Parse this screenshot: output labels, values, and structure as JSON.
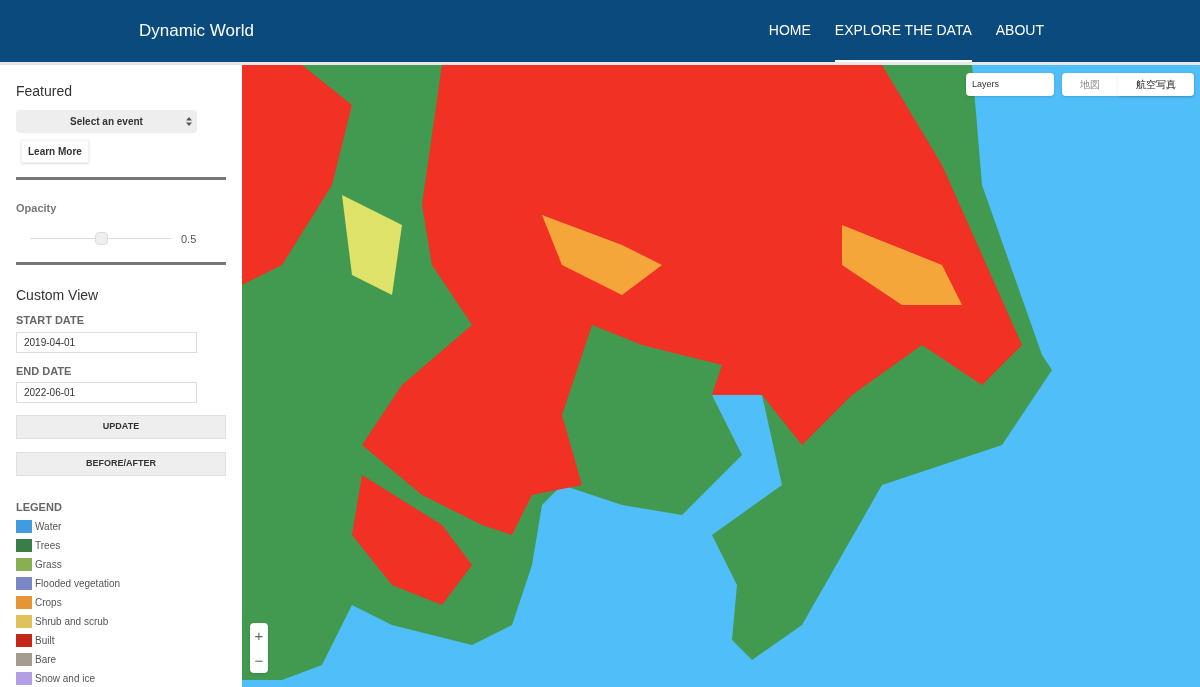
{
  "header": {
    "title": "Dynamic World",
    "nav": [
      {
        "label": "HOME",
        "selected": false
      },
      {
        "label": "EXPLORE THE DATA",
        "selected": true
      },
      {
        "label": "ABOUT",
        "selected": false
      }
    ]
  },
  "sidebar": {
    "featured": {
      "heading": "Featured",
      "select": "Select an event",
      "learn_more": "Learn More"
    },
    "opacity": {
      "heading": "Opacity",
      "level": 0.5,
      "reading": "0.5"
    },
    "custom_view": {
      "heading": "Custom View",
      "start_label": "START DATE",
      "start_value": "2019-04-01",
      "end_label": "END DATE",
      "end_value": "2022-06-01",
      "buttons": [
        "UPDATE",
        "BEFORE/AFTER"
      ]
    },
    "legend": {
      "heading": "LEGEND",
      "items": [
        {
          "label": "Water",
          "color": "#419bdf"
        },
        {
          "label": "Trees",
          "color": "#397d49"
        },
        {
          "label": "Grass",
          "color": "#88b053"
        },
        {
          "label": "Flooded vegetation",
          "color": "#7a87c6"
        },
        {
          "label": "Crops",
          "color": "#e49635"
        },
        {
          "label": "Shrub and scrub",
          "color": "#dfc35a"
        },
        {
          "label": "Built",
          "color": "#c4281b"
        },
        {
          "label": "Bare",
          "color": "#a59b8f"
        },
        {
          "label": "Snow and ice",
          "color": "#b39fe1"
        }
      ]
    }
  },
  "map": {
    "layers": "Layers",
    "map_types": [
      {
        "label": "地図",
        "selected": false
      },
      {
        "label": "航空写真",
        "selected": true
      }
    ],
    "zoom": [
      "+",
      "−"
    ]
  }
}
